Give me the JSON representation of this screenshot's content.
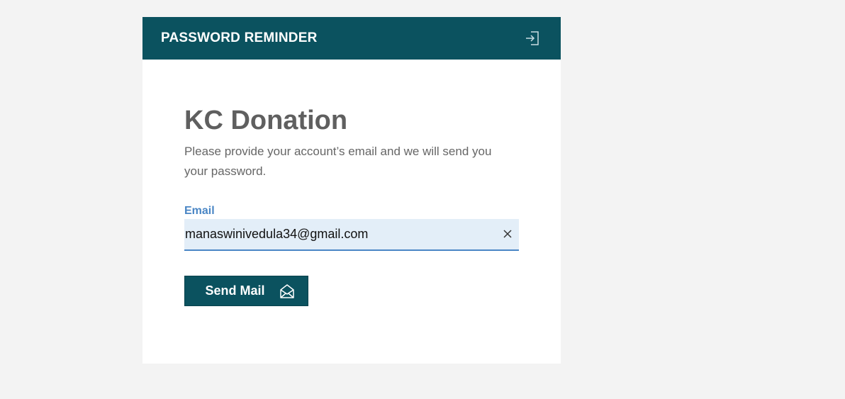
{
  "header": {
    "title": "PASSWORD REMINDER",
    "login_icon": "login-icon"
  },
  "main": {
    "app_name": "KC Donation",
    "description": "Please provide your account’s email and we will send you your password.",
    "email_label": "Email",
    "email_value": "manaswinivedula34@gmail.com",
    "clear_icon": "close-icon",
    "send_label": "Send Mail",
    "send_icon": "open-envelope-icon"
  },
  "colors": {
    "header_bg": "#0b525f",
    "accent": "#4a86c5",
    "input_bg": "#e3eef8",
    "page_bg": "#f3f3f3"
  }
}
